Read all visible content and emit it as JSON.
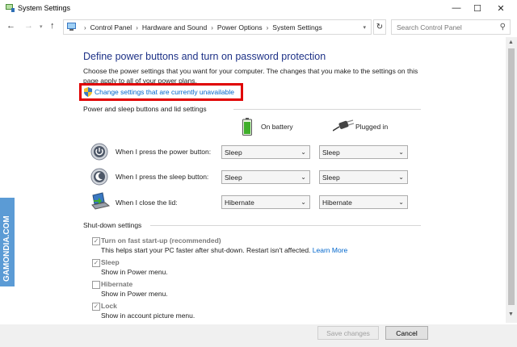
{
  "window": {
    "title": "System Settings",
    "icons": {
      "app": "power-options-icon",
      "minimize": "minimize-icon",
      "maximize": "maximize-icon",
      "close": "close-icon"
    }
  },
  "address": {
    "breadcrumbs": [
      "Control Panel",
      "Hardware and Sound",
      "Power Options",
      "System Settings"
    ],
    "search_placeholder": "Search Control Panel"
  },
  "page": {
    "title": "Define power buttons and turn on password protection",
    "description": "Choose the power settings that you want for your computer. The changes that you make to the settings on this page apply to all of your power plans.",
    "change_link": "Change settings that are currently unavailable",
    "highlight_color": "#e00000",
    "link_color": "#0066cc",
    "title_color": "#1e3287"
  },
  "power_section": {
    "title": "Power and sleep buttons and lid settings",
    "columns": {
      "battery": "On battery",
      "plugged": "Plugged in"
    },
    "rows": [
      {
        "label": "When I press the power button:",
        "icon": "power-button-icon",
        "battery": "Sleep",
        "plugged": "Sleep"
      },
      {
        "label": "When I press the sleep button:",
        "icon": "sleep-button-icon",
        "battery": "Sleep",
        "plugged": "Sleep"
      },
      {
        "label": "When I close the lid:",
        "icon": "laptop-lid-icon",
        "battery": "Hibernate",
        "plugged": "Hibernate"
      }
    ]
  },
  "shutdown_section": {
    "title": "Shut-down settings",
    "items": [
      {
        "label": "Turn on fast start-up (recommended)",
        "description": "This helps start your PC faster after shut-down. Restart isn't affected.",
        "link": "Learn More",
        "checked": true
      },
      {
        "label": "Sleep",
        "description": "Show in Power menu.",
        "checked": true
      },
      {
        "label": "Hibernate",
        "description": "Show in Power menu.",
        "checked": false
      },
      {
        "label": "Lock",
        "description": "Show in account picture menu.",
        "checked": true
      }
    ]
  },
  "footer": {
    "save": "Save changes",
    "cancel": "Cancel"
  },
  "watermark": "GAMONDIA.COM"
}
